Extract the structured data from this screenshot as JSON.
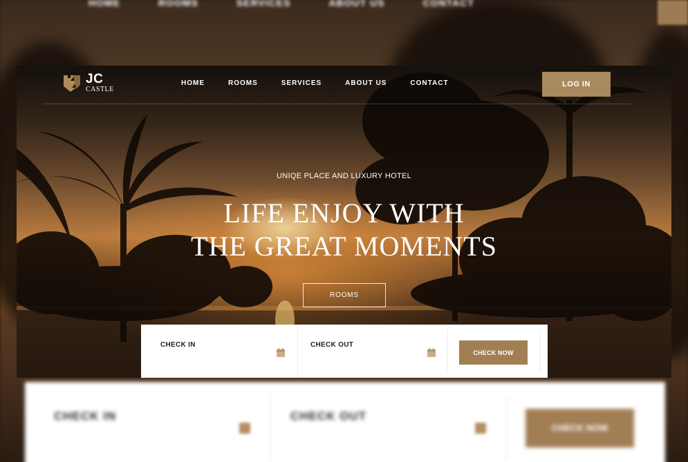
{
  "brand": {
    "name": "JC",
    "subtitle": "CASTLE",
    "accent_color": "#a98a5e"
  },
  "nav": {
    "items": [
      {
        "label": "HOME"
      },
      {
        "label": "ROOMS"
      },
      {
        "label": "SERVICES"
      },
      {
        "label": "ABOUT US"
      },
      {
        "label": "CONTACT"
      }
    ],
    "login_label": "LOG IN"
  },
  "hero": {
    "subtitle": "UNIQE PLACE AND LUXURY HOTEL",
    "title_line1": "LIFE ENJOY WITH",
    "title_line2": "THE GREAT MOMENTS",
    "button_label": "ROOMS"
  },
  "booking": {
    "check_in_label": "CHECK IN",
    "check_out_label": "CHECK OUT",
    "submit_label": "CHECK NOW"
  },
  "icons": {
    "calendar": "calendar-icon",
    "logo": "castle-logo-icon"
  }
}
